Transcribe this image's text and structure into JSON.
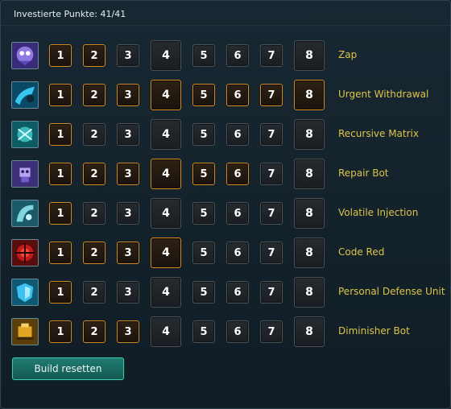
{
  "header": {
    "title": "Investierte Punkte: 41/41"
  },
  "colors": {
    "skill_name": "#dcc44a",
    "tier_active_border": "#d08a26",
    "tier_inactive_border": "#4b5256",
    "reset_button": "#1f7a70"
  },
  "skills": [
    {
      "name": "Zap",
      "icon": "zap-icon",
      "tiers": [
        "1",
        "2",
        "3",
        "4",
        "5",
        "6",
        "7",
        "8"
      ],
      "active_tier": 2
    },
    {
      "name": "Urgent Withdrawal",
      "icon": "urgent-withdrawal-icon",
      "tiers": [
        "1",
        "2",
        "3",
        "4",
        "5",
        "6",
        "7",
        "8"
      ],
      "active_tier": 8
    },
    {
      "name": "Recursive Matrix",
      "icon": "recursive-matrix-icon",
      "tiers": [
        "1",
        "2",
        "3",
        "4",
        "5",
        "6",
        "7",
        "8"
      ],
      "active_tier": 1
    },
    {
      "name": "Repair Bot",
      "icon": "repair-bot-icon",
      "tiers": [
        "1",
        "2",
        "3",
        "4",
        "5",
        "6",
        "7",
        "8"
      ],
      "active_tier": 6
    },
    {
      "name": "Volatile Injection",
      "icon": "volatile-injection-icon",
      "tiers": [
        "1",
        "2",
        "3",
        "4",
        "5",
        "6",
        "7",
        "8"
      ],
      "active_tier": 1
    },
    {
      "name": "Code Red",
      "icon": "code-red-icon",
      "tiers": [
        "1",
        "2",
        "3",
        "4",
        "5",
        "6",
        "7",
        "8"
      ],
      "active_tier": 4
    },
    {
      "name": "Personal Defense Unit",
      "icon": "personal-defense-unit-icon",
      "tiers": [
        "1",
        "2",
        "3",
        "4",
        "5",
        "6",
        "7",
        "8"
      ],
      "active_tier": 1
    },
    {
      "name": "Diminisher Bot",
      "icon": "diminisher-bot-icon",
      "tiers": [
        "1",
        "2",
        "3",
        "4",
        "5",
        "6",
        "7",
        "8"
      ],
      "active_tier": 3
    }
  ],
  "footer": {
    "reset_label": "Build resetten"
  }
}
